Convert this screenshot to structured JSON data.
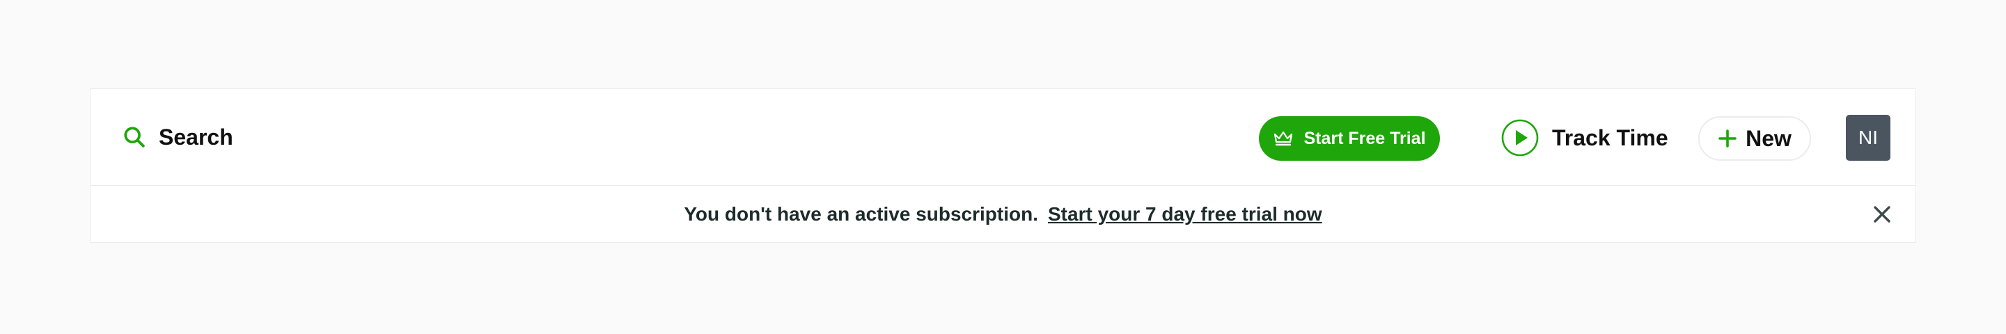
{
  "colors": {
    "accent": "#1fa60a",
    "avatar_bg": "#4b5560",
    "text": "#111111",
    "banner_text": "#1d2b2b",
    "close_icon": "#3d4a4a"
  },
  "header": {
    "search": {
      "label": "Search",
      "icon": "search-icon"
    },
    "trial_button": {
      "label": "Start Free Trial",
      "icon": "crown-icon"
    },
    "track_time": {
      "label": "Track Time",
      "icon": "play-circle-icon"
    },
    "new_button": {
      "label": "New",
      "icon": "plus-icon"
    },
    "avatar": {
      "initials": "NI"
    }
  },
  "banner": {
    "message": "You don't have an active subscription.",
    "link_text": "Start your 7 day free trial now",
    "close_icon": "close-icon"
  }
}
